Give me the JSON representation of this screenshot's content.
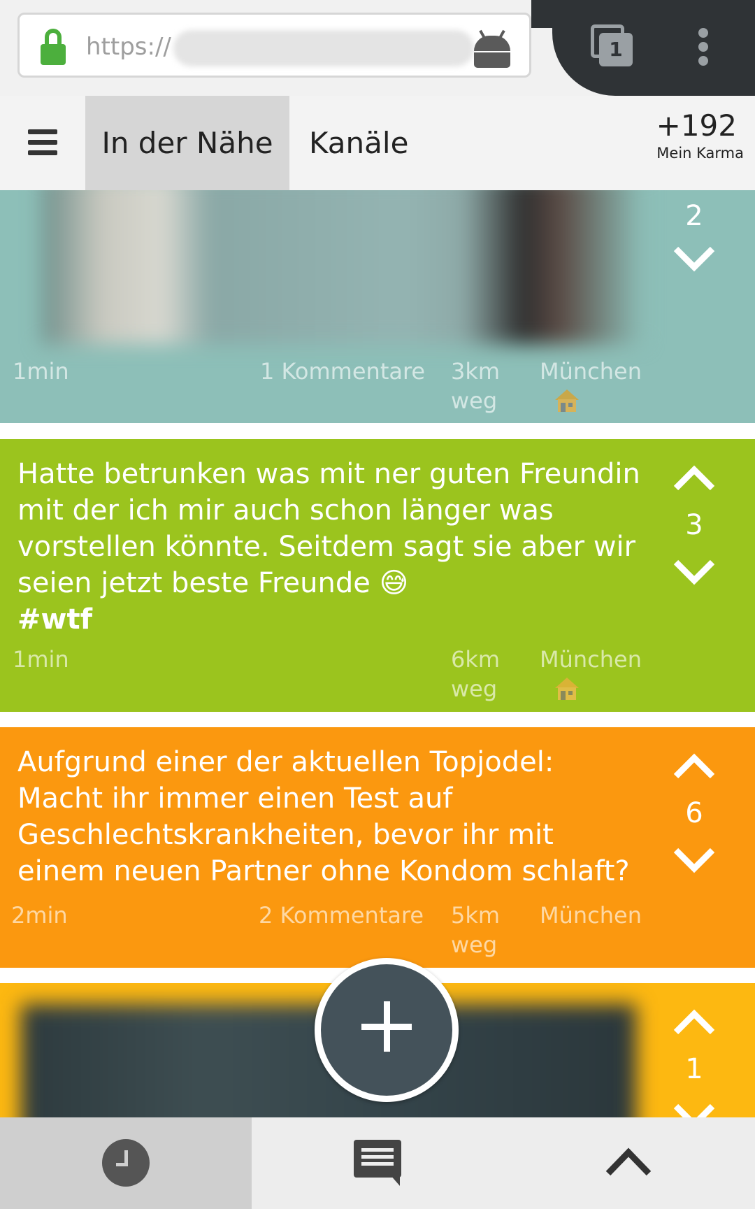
{
  "browser": {
    "url_prefix": "https://",
    "tab_count": "1"
  },
  "header": {
    "tabs": [
      {
        "label": "In der Nähe",
        "active": true
      },
      {
        "label": "Kanäle",
        "active": false
      }
    ],
    "karma_value": "+192",
    "karma_label": "Mein Karma"
  },
  "posts": [
    {
      "color": "#8dbfb8",
      "time": "1min",
      "comments": "1 Kommentare",
      "distance": "3km\nweg",
      "location": "München",
      "votes": "2"
    },
    {
      "color": "#9bc41e",
      "text": "Hatte betrunken was mit ner guten Freundin mit der ich mir auch schon länger was vorstellen könnte. Seitdem sagt sie aber wir seien jetzt beste Freunde 😅",
      "tag": "#wtf",
      "time": "1min",
      "distance": "6km\nweg",
      "location": "München",
      "votes": "3"
    },
    {
      "color": "#fb980f",
      "text": "Aufgrund einer der aktuellen Topjodel: Macht ihr immer einen Test auf Geschlechtskrankheiten, bevor ihr mit einem neuen Partner ohne Kondom schlaft?",
      "time": "2min",
      "comments": "2 Kommentare",
      "distance": "5km\nweg",
      "location": "München",
      "votes": "6"
    },
    {
      "color": "#fdb811",
      "votes": "1"
    }
  ],
  "icons": {
    "lock": "lock-icon",
    "android": "android-icon",
    "menu": "hamburger-icon",
    "home": "house-icon",
    "add": "plus-icon",
    "recent": "clock-icon",
    "comments": "comment-icon",
    "top": "chevron-up-icon"
  }
}
